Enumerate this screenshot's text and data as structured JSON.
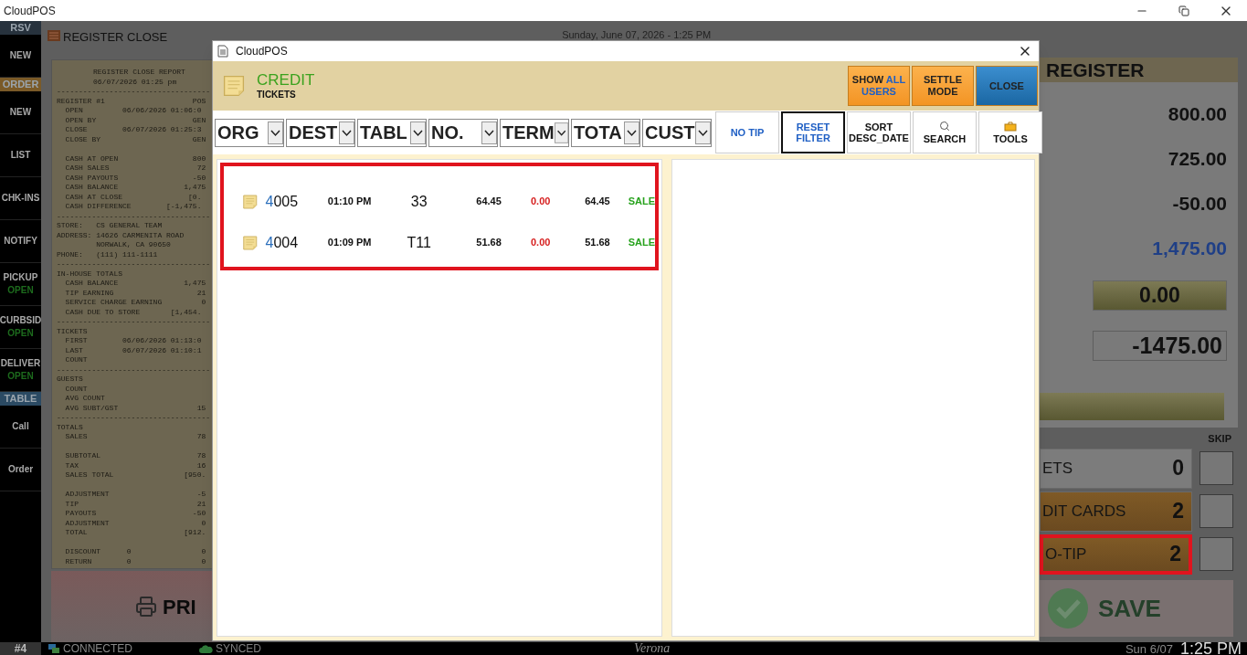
{
  "window": {
    "title": "CloudPOS"
  },
  "sidebar": {
    "items": [
      {
        "kind": "header",
        "label": "RSV",
        "color": "#27323d"
      },
      {
        "kind": "button",
        "label": "NEW"
      },
      {
        "kind": "header",
        "label": "ORDER",
        "color": "#7a5a28"
      },
      {
        "kind": "button",
        "label": "NEW"
      },
      {
        "kind": "button",
        "label": "LIST"
      },
      {
        "kind": "button",
        "label": "CHK-INS"
      },
      {
        "kind": "button",
        "label": "NOTIFY"
      },
      {
        "kind": "button",
        "label": "PICKUP",
        "status": "OPEN"
      },
      {
        "kind": "button",
        "label": "CURBSID",
        "status": "OPEN"
      },
      {
        "kind": "button",
        "label": "DELIVER",
        "status": "OPEN"
      },
      {
        "kind": "header",
        "label": "TABLE",
        "color": "#2b4a63"
      },
      {
        "kind": "button",
        "label": "Call"
      },
      {
        "kind": "button",
        "label": "Order"
      }
    ]
  },
  "page": {
    "title": "REGISTER CLOSE",
    "datetime": "Sunday, June 07, 2026 - 1:25 PM"
  },
  "report": {
    "lines": [
      {
        "kind": "title",
        "text": "REGISTER CLOSE REPORT"
      },
      {
        "kind": "title",
        "text": "06/07/2026 01:25 pm"
      },
      {
        "kind": "line",
        "text": "-----------------------------------"
      },
      {
        "kind": "line",
        "text": "REGISTER #1                    POS"
      },
      {
        "kind": "line",
        "text": "  OPEN         06/06/2026 01:06:0"
      },
      {
        "kind": "line",
        "text": "  OPEN BY                      GEN"
      },
      {
        "kind": "line",
        "text": "  CLOSE        06/07/2026 01:25:3"
      },
      {
        "kind": "line",
        "text": "  CLOSE BY                     GEN"
      },
      {
        "kind": "blank"
      },
      {
        "kind": "line",
        "text": "  CASH AT OPEN                 800"
      },
      {
        "kind": "line",
        "text": "  CASH SALES                    72"
      },
      {
        "kind": "line",
        "text": "  CASH PAYOUTS                 -50"
      },
      {
        "kind": "line",
        "text": "  CASH BALANCE               1,475"
      },
      {
        "kind": "line",
        "text": "  CASH AT CLOSE               [0."
      },
      {
        "kind": "line",
        "text": "  CASH DIFFERENCE        [-1,475."
      },
      {
        "kind": "line",
        "text": "-----------------------------------"
      },
      {
        "kind": "line",
        "text": "STORE:   CS GENERAL TEAM"
      },
      {
        "kind": "line",
        "text": "ADDRESS: 14626 CARMENITA ROAD"
      },
      {
        "kind": "line",
        "text": "         NORWALK, CA 90650"
      },
      {
        "kind": "line",
        "text": "PHONE:   (111) 111-1111"
      },
      {
        "kind": "line",
        "text": "-----------------------------------"
      },
      {
        "kind": "line",
        "text": "IN-HOUSE TOTALS"
      },
      {
        "kind": "line",
        "text": "  CASH BALANCE               1,475"
      },
      {
        "kind": "line",
        "text": "  TIP EARNING                   21"
      },
      {
        "kind": "line",
        "text": "  SERVICE CHARGE EARNING         0"
      },
      {
        "kind": "line",
        "text": "  CASH DUE TO STORE       [1,454."
      },
      {
        "kind": "line",
        "text": "-----------------------------------"
      },
      {
        "kind": "line",
        "text": "TICKETS"
      },
      {
        "kind": "line",
        "text": "  FIRST        06/06/2026 01:13:0"
      },
      {
        "kind": "line",
        "text": "  LAST         06/07/2026 01:10:1"
      },
      {
        "kind": "line",
        "text": "  COUNT"
      },
      {
        "kind": "line",
        "text": "-----------------------------------"
      },
      {
        "kind": "line",
        "text": "GUESTS"
      },
      {
        "kind": "line",
        "text": "  COUNT"
      },
      {
        "kind": "line",
        "text": "  AVG COUNT"
      },
      {
        "kind": "line",
        "text": "  AVG SUBT/GST                  15"
      },
      {
        "kind": "line",
        "text": "-----------------------------------"
      },
      {
        "kind": "line",
        "text": "TOTALS"
      },
      {
        "kind": "line",
        "text": "  SALES                         78"
      },
      {
        "kind": "blank"
      },
      {
        "kind": "line",
        "text": "  SUBTOTAL                      78"
      },
      {
        "kind": "line",
        "text": "  TAX                           16"
      },
      {
        "kind": "line",
        "text": "  SALES TOTAL                [950."
      },
      {
        "kind": "blank"
      },
      {
        "kind": "line",
        "text": "  ADJUSTMENT                    -5"
      },
      {
        "kind": "line",
        "text": "  TIP                           21"
      },
      {
        "kind": "line",
        "text": "  PAYOUTS                      -50"
      },
      {
        "kind": "line",
        "text": "  ADJUSTMENT                     0"
      },
      {
        "kind": "line",
        "text": "  TOTAL                      [912."
      },
      {
        "kind": "blank"
      },
      {
        "kind": "line",
        "text": "  DISCOUNT      0                0"
      },
      {
        "kind": "line",
        "text": "  RETURN        0                0"
      }
    ]
  },
  "print_button": {
    "label": "PRI"
  },
  "register_panel": {
    "title": "REGISTER",
    "values": [
      {
        "kind": "plain",
        "text": "800.00"
      },
      {
        "kind": "plain",
        "text": "725.00"
      },
      {
        "kind": "plain",
        "text": "-50.00"
      },
      {
        "kind": "accent",
        "text": "1,475.00"
      },
      {
        "kind": "olive_field",
        "text": "0.00"
      },
      {
        "kind": "boxed_field",
        "text": "-1475.00"
      }
    ]
  },
  "skip_label": "SKIP",
  "summary_rows": [
    {
      "kind": "plain",
      "label": "ETS",
      "count": "0",
      "highlighted": false,
      "checked": false
    },
    {
      "kind": "accent",
      "label": "DIT CARDS",
      "count": "2",
      "highlighted": false,
      "checked": false
    },
    {
      "kind": "accent",
      "label": "O-TIP",
      "count": "2",
      "highlighted": true,
      "checked": false
    }
  ],
  "save_button": {
    "label": "SAVE",
    "disabled": true
  },
  "dialog": {
    "title": "CloudPOS",
    "heading": "CREDIT",
    "subheading": "TICKETS",
    "actions": [
      {
        "kind": "orange",
        "lines": [
          [
            {
              "text": "SHOW",
              "accent": false
            },
            {
              "text": "ALL",
              "accent": true
            }
          ],
          [
            {
              "text": "USERS",
              "accent": true
            }
          ]
        ]
      },
      {
        "kind": "orange",
        "lines": [
          [
            {
              "text": "SETTLE",
              "accent": false
            }
          ],
          [
            {
              "text": "MODE",
              "accent": false
            }
          ]
        ]
      },
      {
        "kind": "blue",
        "lines": [
          [
            {
              "text": "CLOSE",
              "accent": false
            }
          ]
        ]
      }
    ],
    "filters": [
      {
        "label": "ORG"
      },
      {
        "label": "DEST"
      },
      {
        "label": "TABL"
      },
      {
        "label": "NO."
      },
      {
        "label": "TERM"
      },
      {
        "label": "TOTA"
      },
      {
        "label": "CUST"
      }
    ],
    "tools": [
      {
        "kind": "link",
        "lines": [
          "NO TIP"
        ],
        "selected": false
      },
      {
        "kind": "link",
        "lines": [
          "RESET",
          "FILTER"
        ],
        "selected": true
      },
      {
        "kind": "text",
        "lines": [
          "SORT",
          "DESC_DATE"
        ],
        "selected": false
      },
      {
        "kind": "search",
        "lines": [
          "SEARCH"
        ],
        "selected": false
      },
      {
        "kind": "tools",
        "lines": [
          "TOOLS"
        ],
        "selected": false
      }
    ],
    "tickets": {
      "highlighted": true,
      "rows": [
        {
          "number": "4005",
          "time": "01:10 PM",
          "table": "33",
          "amount": "64.45",
          "tip": "0.00",
          "total": "64.45",
          "status": "SALE"
        },
        {
          "number": "4004",
          "time": "01:09 PM",
          "table": "T11",
          "amount": "51.68",
          "tip": "0.00",
          "total": "51.68",
          "status": "SALE"
        }
      ]
    }
  },
  "status_bar": {
    "terminal": "#4",
    "connection": "CONNECTED",
    "sync": "SYNCED",
    "brand": "Verona",
    "date": "Sun 6/07",
    "time": "1:25 PM"
  }
}
